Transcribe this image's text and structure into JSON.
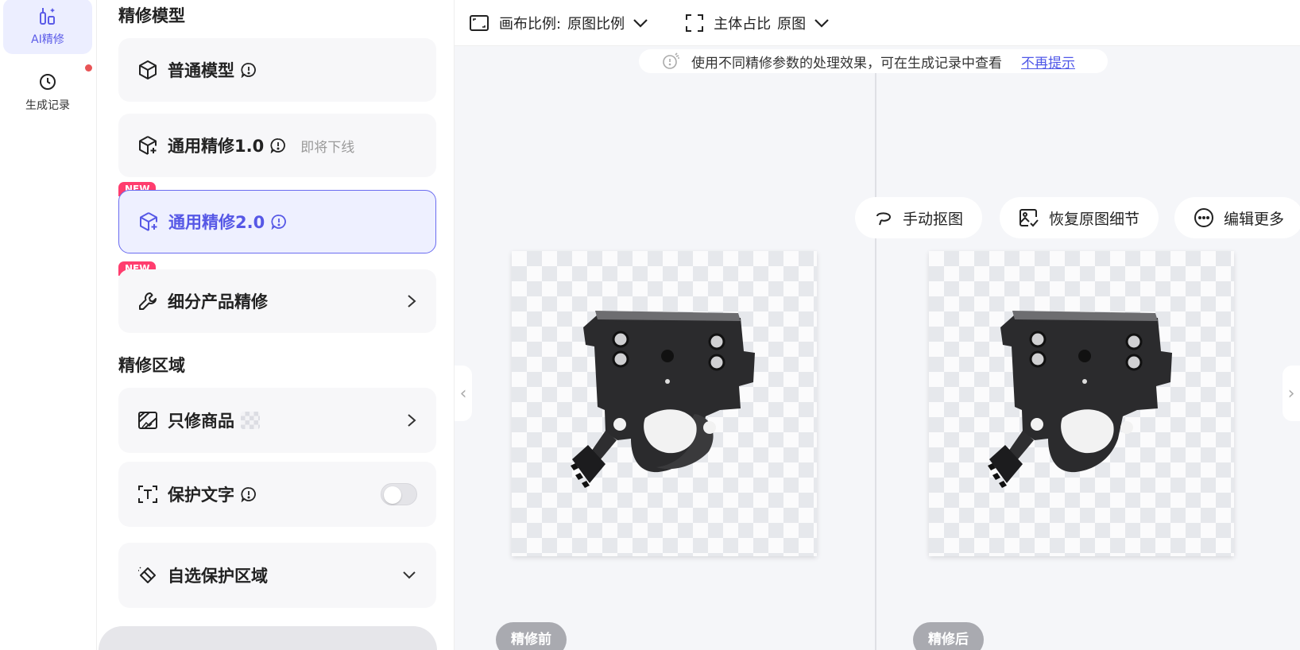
{
  "rail": {
    "items": [
      {
        "label": "AI精修",
        "icon": "ai-retouch-icon",
        "active": true
      },
      {
        "label": "生成记录",
        "icon": "clock-icon",
        "active": false
      }
    ],
    "notification_color": "#e85456"
  },
  "panel": {
    "model_section_title": "精修模型",
    "models": [
      {
        "label": "普通模型",
        "icon": "cube-icon"
      },
      {
        "label": "通用精修1.0",
        "icon": "cube-plus-icon",
        "note": "即将下线"
      },
      {
        "label": "通用精修2.0",
        "icon": "cube-plus-icon",
        "badge": "NEW",
        "selected": true
      },
      {
        "label": "细分产品精修",
        "icon": "wrench-icon",
        "badge": "NEW"
      }
    ],
    "area_section_title": "精修区域",
    "areas": [
      {
        "label": "只修商品",
        "icon": "image-edit-icon"
      },
      {
        "label": "保护文字",
        "icon": "text-frame-icon",
        "toggle": false
      },
      {
        "label": "自选保护区域",
        "icon": "eraser-icon"
      }
    ],
    "accent": "#5658e6",
    "badge_color": "#ff3d6e"
  },
  "toolbar": {
    "canvas_ratio_label": "画布比例:",
    "canvas_ratio_value": "原图比例",
    "subject_ratio_label": "主体占比",
    "subject_ratio_value": "原图"
  },
  "canvas": {
    "tip_text": "使用不同精修参数的处理效果，可在生成记录中查看",
    "tip_link": "不再提示",
    "chips": [
      "手动抠图",
      "恢复原图细节",
      "编辑更多"
    ],
    "before_label": "精修前",
    "after_label": "精修后",
    "left_arrow": "‹",
    "right_arrow": "›"
  }
}
